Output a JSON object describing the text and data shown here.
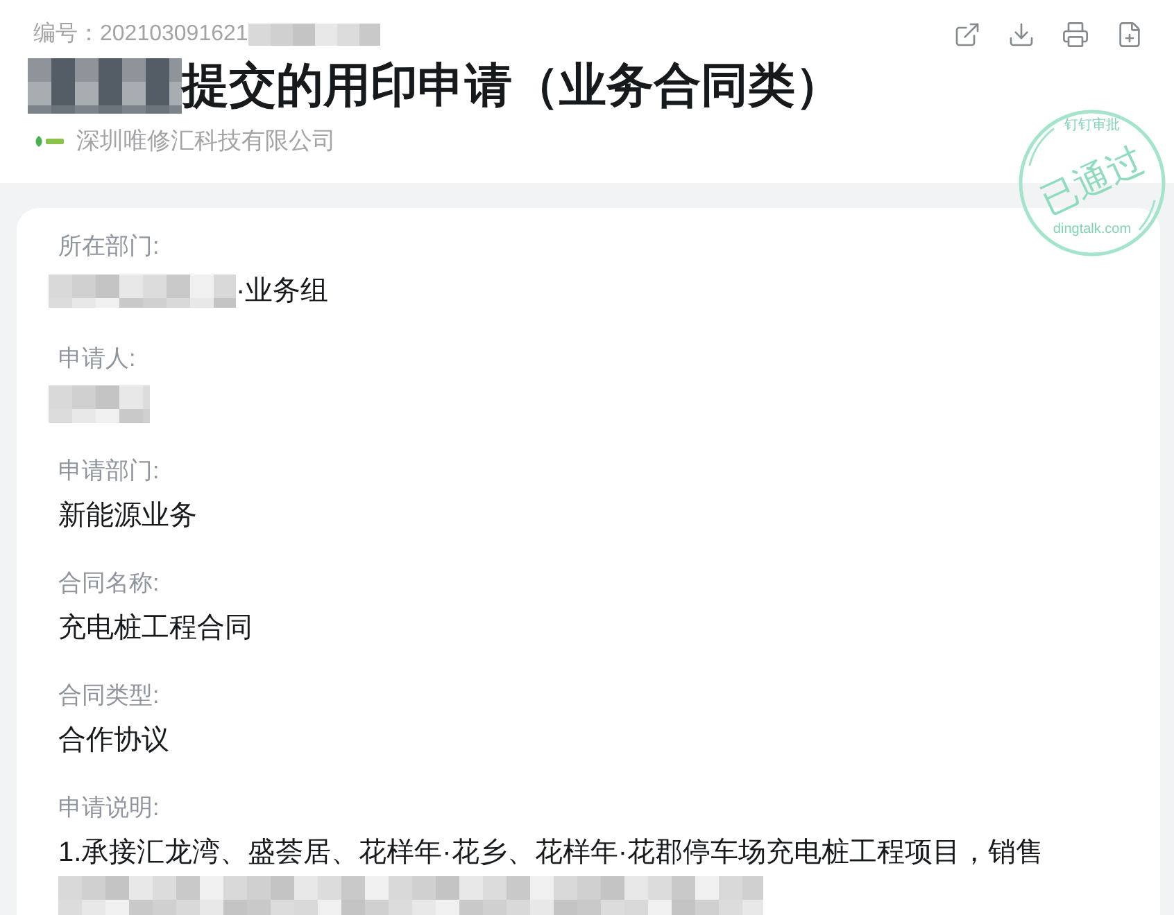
{
  "header": {
    "serial": {
      "label": "编号：",
      "value": "202103091621",
      "masked": true
    },
    "title": {
      "text": "提交的用印申请（业务合同类）",
      "masked": true
    },
    "company": {
      "name": "深圳唯修汇科技有限公司"
    }
  },
  "stamp": {
    "caption": "钉钉审批",
    "status": "已通过",
    "domain": "dingtalk.com"
  },
  "fields": [
    {
      "kind": "premasked",
      "label": "所在部门:",
      "value": "·业务组"
    },
    {
      "kind": "masked",
      "label": "申请人:"
    },
    {
      "kind": "plain",
      "label": "申请部门:",
      "value": "新能源业务"
    },
    {
      "kind": "plain",
      "label": "合同名称:",
      "value": "充电桩工程合同"
    },
    {
      "kind": "plain",
      "label": "合同类型:",
      "value": "合作协议"
    },
    {
      "kind": "postmasked",
      "label": "申请说明:",
      "value": "1.承接汇龙湾、盛荟居、花样年·花乡、花样年·花郡停车场充电桩工程项目，销售"
    }
  ]
}
